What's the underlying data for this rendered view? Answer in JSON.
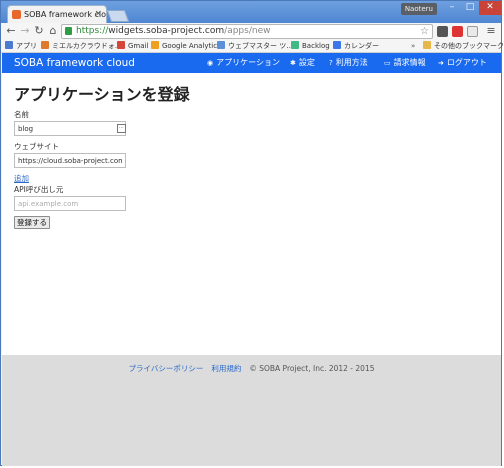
{
  "browser": {
    "tab_title": "SOBA framework cloud",
    "user_badge": "Naoteru",
    "url": {
      "scheme": "https://",
      "host": "widgets.soba-project.com",
      "path": "/apps/new"
    }
  },
  "bookmarks": [
    {
      "label": "アプリ",
      "icon": "apps-grid-icon",
      "color": "#4a7bd0"
    },
    {
      "label": "ミエルカクラウドォ…",
      "icon": "mieruka-icon",
      "color": "#e0792a"
    },
    {
      "label": "Gmail",
      "icon": "gmail-icon",
      "color": "#d44638"
    },
    {
      "label": "Google Analytics",
      "icon": "analytics-icon",
      "color": "#f0a020"
    },
    {
      "label": "ウェブマスター ツ…",
      "icon": "webmaster-icon",
      "color": "#5b8fd8"
    },
    {
      "label": "Backlog",
      "icon": "backlog-icon",
      "color": "#42b883"
    },
    {
      "label": "カレンダー",
      "icon": "calendar-icon",
      "color": "#3b78e7"
    },
    {
      "label": "その他のブックマーク",
      "icon": "folder-icon",
      "color": "#e6b84a"
    }
  ],
  "app": {
    "brand": "SOBA framework cloud",
    "nav": [
      {
        "label": "アプリケーション",
        "icon": "globe-icon"
      },
      {
        "label": "設定",
        "icon": "gear-icon"
      },
      {
        "label": "利用方法",
        "icon": "question-icon"
      },
      {
        "label": "請求情報",
        "icon": "credit-card-icon"
      },
      {
        "label": "ログアウト",
        "icon": "logout-icon"
      }
    ],
    "accent": "#1a6af0"
  },
  "form": {
    "title": "アプリケーションを登録",
    "name_label": "名前",
    "name_value": "blog",
    "website_label": "ウェブサイト",
    "website_value": "https://cloud.soba-project.com/bl",
    "add_link": "追加",
    "api_label": "API呼び出し元",
    "api_placeholder": "api.example.com",
    "submit_label": "登録する"
  },
  "footer": {
    "privacy": "プライバシーポリシー",
    "terms": "利用規約",
    "copyright": "© SOBA Project, Inc. 2012 - 2015"
  }
}
